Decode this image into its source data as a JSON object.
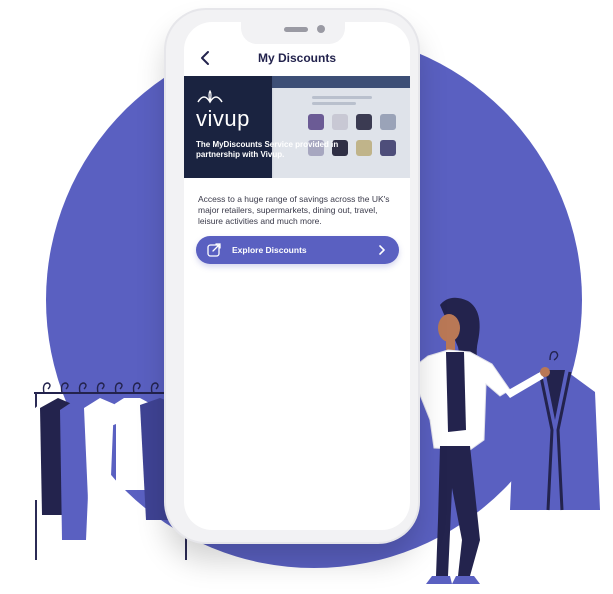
{
  "nav": {
    "title": "My Discounts",
    "back_icon": "chevron-left-icon"
  },
  "hero": {
    "logo_text": "vivup",
    "caption": "The MyDiscounts Service provided in partnership with Vivup."
  },
  "body": {
    "description": "Access to a huge range of savings across the UK's major retailers, supermarkets, dining out, travel, leisure activities and much more."
  },
  "cta": {
    "label": "Explore Discounts",
    "icon": "external-link-icon",
    "chevron": "chevron-right-icon"
  },
  "colors": {
    "accent": "#5a60c1",
    "background_circle": "#5a60c1",
    "navy": "#23234d",
    "hero_bg": "#1a2340"
  }
}
